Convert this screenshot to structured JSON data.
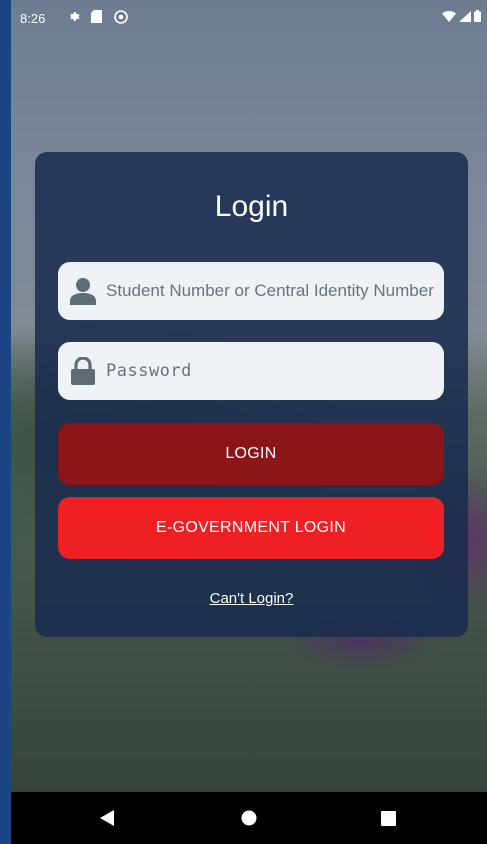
{
  "status_bar": {
    "time": "8:26",
    "left_icons": [
      "gear-icon",
      "sd-card-icon",
      "hotspot-icon"
    ],
    "right_icons": [
      "wifi-icon",
      "signal-icon",
      "battery-icon"
    ]
  },
  "login": {
    "title": "Login",
    "username_placeholder": "Student Number or Central Identity Number",
    "password_placeholder": "Password",
    "login_button": "LOGIN",
    "egov_button": "E-GOVERNMENT LOGIN",
    "cant_login_link": "Can't Login?"
  },
  "colors": {
    "card_bg": "#182b4e",
    "login_button": "#8b1518",
    "egov_button": "#ee2024",
    "field_bg": "#eef1f5",
    "icon_gray": "#5f6b75"
  },
  "nav_bar": {
    "icons": [
      "back-triangle-icon",
      "home-circle-icon",
      "recents-square-icon"
    ]
  }
}
